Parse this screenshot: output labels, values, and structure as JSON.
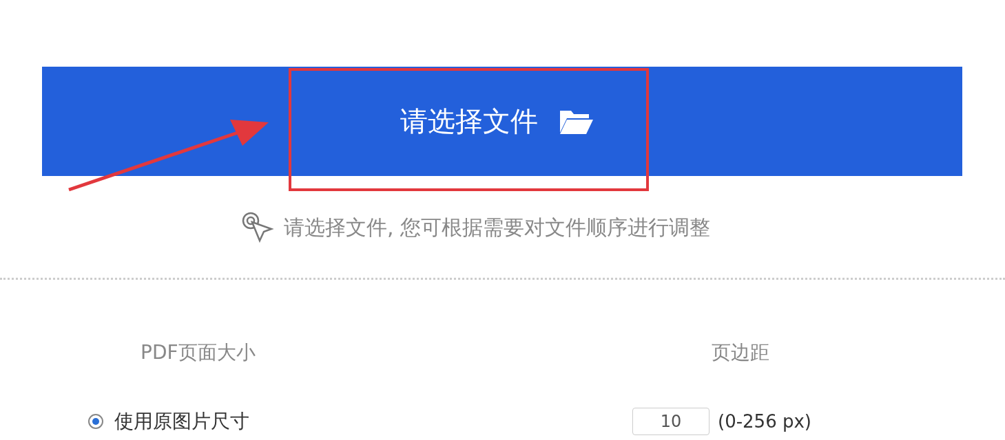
{
  "upload_button": {
    "label": "请选择文件"
  },
  "hint": "请选择文件, 您可根据需要对文件顺序进行调整",
  "page_size": {
    "label": "PDF页面大小",
    "choices": [
      {
        "label": "使用原图片尺寸",
        "selected": true
      }
    ]
  },
  "margin": {
    "label": "页边距",
    "value": "10",
    "range": "(0-256 px)"
  }
}
